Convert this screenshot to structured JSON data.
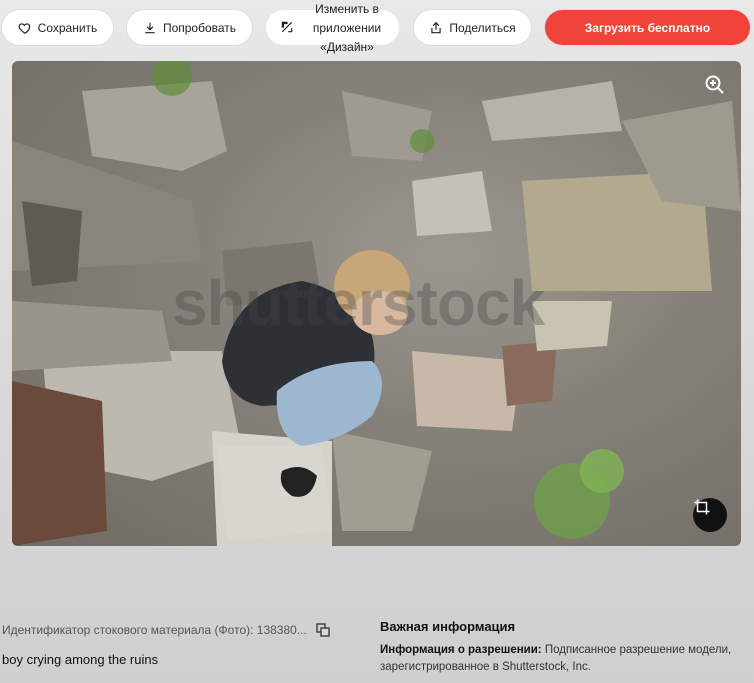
{
  "toolbar": {
    "save_label": "Сохранить",
    "try_label": "Попробовать",
    "edit_label_line1": "Изменить в",
    "edit_label_line2": "приложении",
    "edit_label_line3": "«Дизайн»",
    "share_label": "Поделиться",
    "upload_label": "Загрузить бесплатно"
  },
  "photo": {
    "watermark": "shutterstock"
  },
  "details": {
    "stock_id": "Идентификатор стокового материала (Фото): 138380...",
    "description": "boy crying among the ruins"
  },
  "important": {
    "title": "Важная информация",
    "permission_label": "Информация о разрешении:",
    "permission_text": " Подписанное разрешение модели, зарегистрированное в Shutterstock, Inc."
  },
  "colors": {
    "accent": "#f0433a"
  }
}
